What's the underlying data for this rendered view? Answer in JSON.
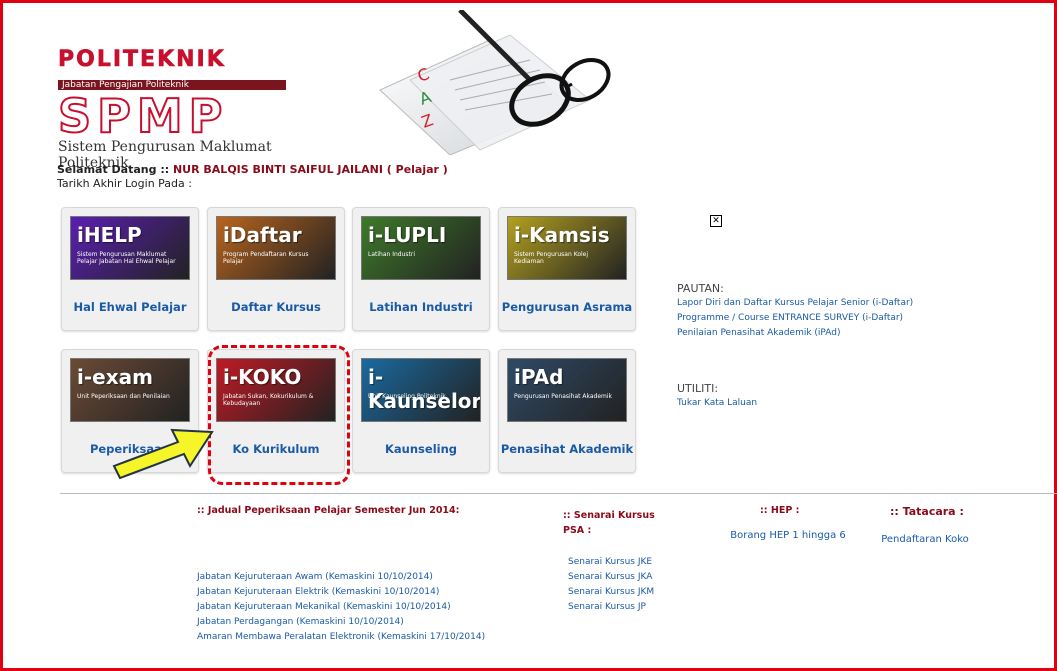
{
  "header": {
    "brand_top": "POLITEKNIK",
    "brand_sub": "Jabatan Pengajian Politeknik",
    "brand_main": "SPMP",
    "brand_tag": "Sistem Pengurusan Maklumat Politeknik"
  },
  "welcome": {
    "prefix": "Selamat Datang ::",
    "name": "NUR BALQIS BINTI SAIFUL JAILANI ( Pelajar )",
    "last_login": "Tarikh Akhir Login Pada :"
  },
  "tiles": [
    {
      "brand": "iHELP",
      "sub": "Sistem Pengurusan Maklumat Pelajar Jabatan Hal Ehwal Pelajar",
      "label": "Hal Ehwal Pelajar",
      "color": "#5a1fb0"
    },
    {
      "brand": "iDaftar",
      "sub": "Program Pendaftaran Kursus Pelajar",
      "label": "Daftar Kursus",
      "color": "#b8641e"
    },
    {
      "brand": "i-LUPLI",
      "sub": "Latihan Industri",
      "label": "Latihan Industri",
      "color": "#3e7a2a"
    },
    {
      "brand": "i-Kamsis",
      "sub": "Sistem Pengurusan Kolej Kediaman",
      "label": "Pengurusan Asrama",
      "color": "#b3a020"
    },
    {
      "brand": "i-exam",
      "sub": "Unit Peperiksaan dan Penilaian",
      "label": "Peperiksaan",
      "color": "#6b4a35"
    },
    {
      "brand": "i-KOKO",
      "sub": "Jabatan Sukan, Kokurikulum & Kebudayaan",
      "label": "Ko Kurikulum",
      "color": "#c01a24"
    },
    {
      "brand": "i-Kaunselor",
      "sub": "Unit Kaunseling Politeknik",
      "label": "Kaunseling",
      "color": "#1a6aa0"
    },
    {
      "brand": "iPAd",
      "sub": "Pengurusan Penasihat Akademik",
      "label": "Penasihat Akademik",
      "color": "#2f4a66"
    }
  ],
  "pautan": {
    "heading": "PAUTAN:",
    "links": [
      "Lapor Diri dan Daftar Kursus Pelajar Senior (i-Daftar)",
      "Programme / Course ENTRANCE SURVEY (i-Daftar)",
      "Penilaian Penasihat Akademik (iPAd)"
    ]
  },
  "utiliti": {
    "heading": "UTILITI:",
    "links": [
      "Tukar Kata Laluan"
    ]
  },
  "footer": {
    "jadual": {
      "heading": ":: Jadual Peperiksaan Pelajar Semester Jun 2014:",
      "links": [
        "Jabatan Kejuruteraan Awam (Kemaskini 10/10/2014)",
        "Jabatan Kejuruteraan Elektrik (Kemaskini 10/10/2014)",
        "Jabatan Kejuruteraan Mekanikal (Kemaskini 10/10/2014)",
        "Jabatan Perdagangan (Kemaskini 10/10/2014)",
        "Amaran Membawa Peralatan Elektronik (Kemaskini 17/10/2014)"
      ]
    },
    "psa": {
      "heading": ":: Senarai Kursus PSA :",
      "links": [
        "Senarai Kursus JKE",
        "Senarai Kursus JKA",
        "Senarai Kursus JKM",
        "Senarai Kursus JP"
      ]
    },
    "hep": {
      "heading": ":: HEP :",
      "link": "Borang HEP 1 hingga 6"
    },
    "tatacara": {
      "heading": ":: Tatacara :",
      "link": "Pendaftaran Koko"
    }
  },
  "colors": {
    "frame": "#e0000f",
    "link": "#1a5aa6",
    "accent": "#8b0a1a",
    "arrow": "#f5f52a"
  }
}
